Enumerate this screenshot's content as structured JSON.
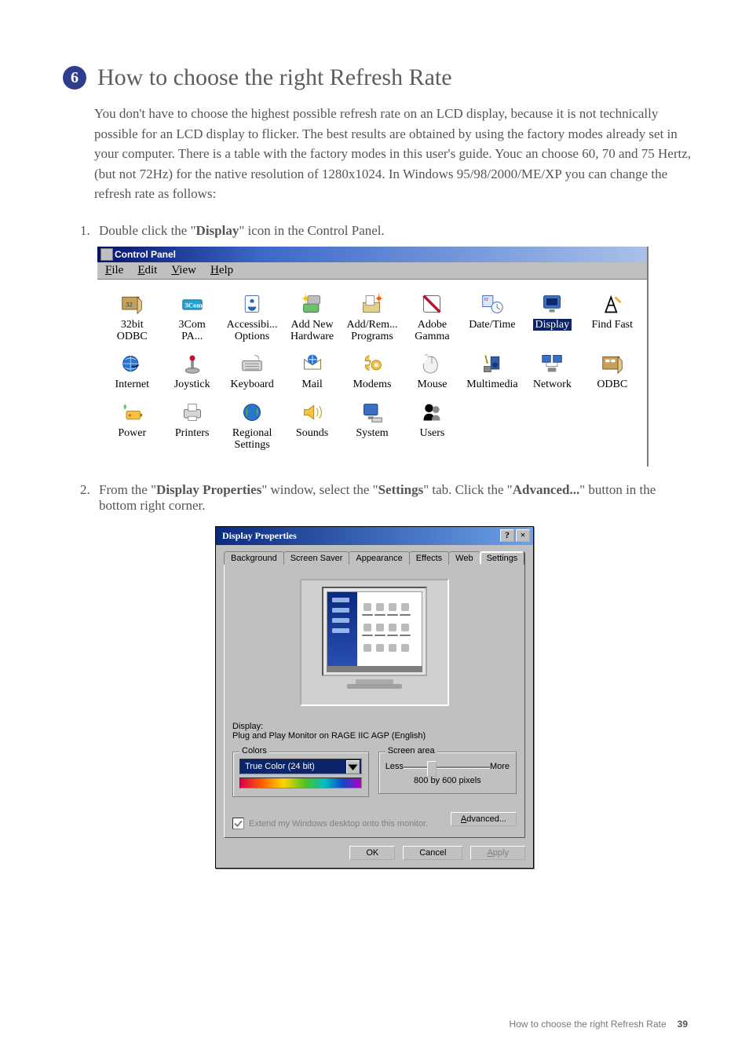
{
  "page": {
    "section_number": "6",
    "heading": "How to choose the right Refresh Rate",
    "body": "You don't have to choose the highest possible refresh rate on an LCD display, because it is not technically possible for an LCD display to flicker. The best results are obtained by using the factory modes already set in your computer. There is a table with the factory modes in this user's guide. Youc an choose 60, 70 and 75 Hertz, (but not 72Hz) for the native resolution of 1280x1024. In Windows 95/98/2000/ME/XP you can change the refresh rate as follows:",
    "step1_num": "1.",
    "step1_a": "Double click the \"",
    "step1_b": "Display",
    "step1_c": "\" icon in the Control Panel.",
    "step2_num": "2.",
    "step2_a": "From the \"",
    "step2_b": "Display Properties",
    "step2_c": "\" window, select the \"",
    "step2_d": "Settings",
    "step2_e": "\" tab. Click the \"",
    "step2_f": "Advanced...",
    "step2_g": "\" button in the bottom right corner."
  },
  "control_panel": {
    "title": "Control Panel",
    "menu": {
      "file": "File",
      "edit": "Edit",
      "view": "View",
      "help": "Help"
    },
    "items": [
      {
        "label_1": "32bit",
        "label_2": "ODBC",
        "icon": "odbc32"
      },
      {
        "label_1": "3Com",
        "label_2": "PA...",
        "icon": "3com"
      },
      {
        "label_1": "Accessibi...",
        "label_2": "Options",
        "icon": "access"
      },
      {
        "label_1": "Add New",
        "label_2": "Hardware",
        "icon": "addhw"
      },
      {
        "label_1": "Add/Rem...",
        "label_2": "Programs",
        "icon": "addprog"
      },
      {
        "label_1": "Adobe",
        "label_2": "Gamma",
        "icon": "gamma"
      },
      {
        "label_1": "Date/Time",
        "label_2": "",
        "icon": "datetime"
      },
      {
        "label_1": "Display",
        "label_2": "",
        "icon": "display",
        "selected": true
      },
      {
        "label_1": "Find Fast",
        "label_2": "",
        "icon": "findfast"
      },
      {
        "label_1": "Internet",
        "label_2": "",
        "icon": "internet"
      },
      {
        "label_1": "Joystick",
        "label_2": "",
        "icon": "joystick"
      },
      {
        "label_1": "Keyboard",
        "label_2": "",
        "icon": "keyboard"
      },
      {
        "label_1": "Mail",
        "label_2": "",
        "icon": "mail"
      },
      {
        "label_1": "Modems",
        "label_2": "",
        "icon": "modems"
      },
      {
        "label_1": "Mouse",
        "label_2": "",
        "icon": "mouse"
      },
      {
        "label_1": "Multimedia",
        "label_2": "",
        "icon": "mm"
      },
      {
        "label_1": "Network",
        "label_2": "",
        "icon": "network"
      },
      {
        "label_1": "ODBC",
        "label_2": "",
        "icon": "odbc"
      },
      {
        "label_1": "Power",
        "label_2": "",
        "icon": "power"
      },
      {
        "label_1": "Printers",
        "label_2": "",
        "icon": "printers"
      },
      {
        "label_1": "Regional",
        "label_2": "Settings",
        "icon": "regional"
      },
      {
        "label_1": "Sounds",
        "label_2": "",
        "icon": "sounds"
      },
      {
        "label_1": "System",
        "label_2": "",
        "icon": "system"
      },
      {
        "label_1": "Users",
        "label_2": "",
        "icon": "users"
      }
    ]
  },
  "display_dialog": {
    "title": "Display Properties",
    "help_btn": "?",
    "close_btn": "×",
    "tabs": [
      "Background",
      "Screen Saver",
      "Appearance",
      "Effects",
      "Web",
      "Settings"
    ],
    "active_tab": "Settings",
    "display_label": "Display:",
    "display_value": "Plug and Play Monitor on RAGE IIC AGP (English)",
    "colors": {
      "legend": "Colors",
      "value": "True Color (24 bit)"
    },
    "screen_area": {
      "legend": "Screen area",
      "less": "Less",
      "more": "More",
      "value": "800 by 600 pixels"
    },
    "extend_checkbox": "Extend my Windows desktop onto this monitor.",
    "advanced_btn": "Advanced...",
    "ok": "OK",
    "cancel": "Cancel",
    "apply": "Apply"
  },
  "footer": {
    "text": "How to choose the right Refresh Rate",
    "page_number": "39"
  }
}
